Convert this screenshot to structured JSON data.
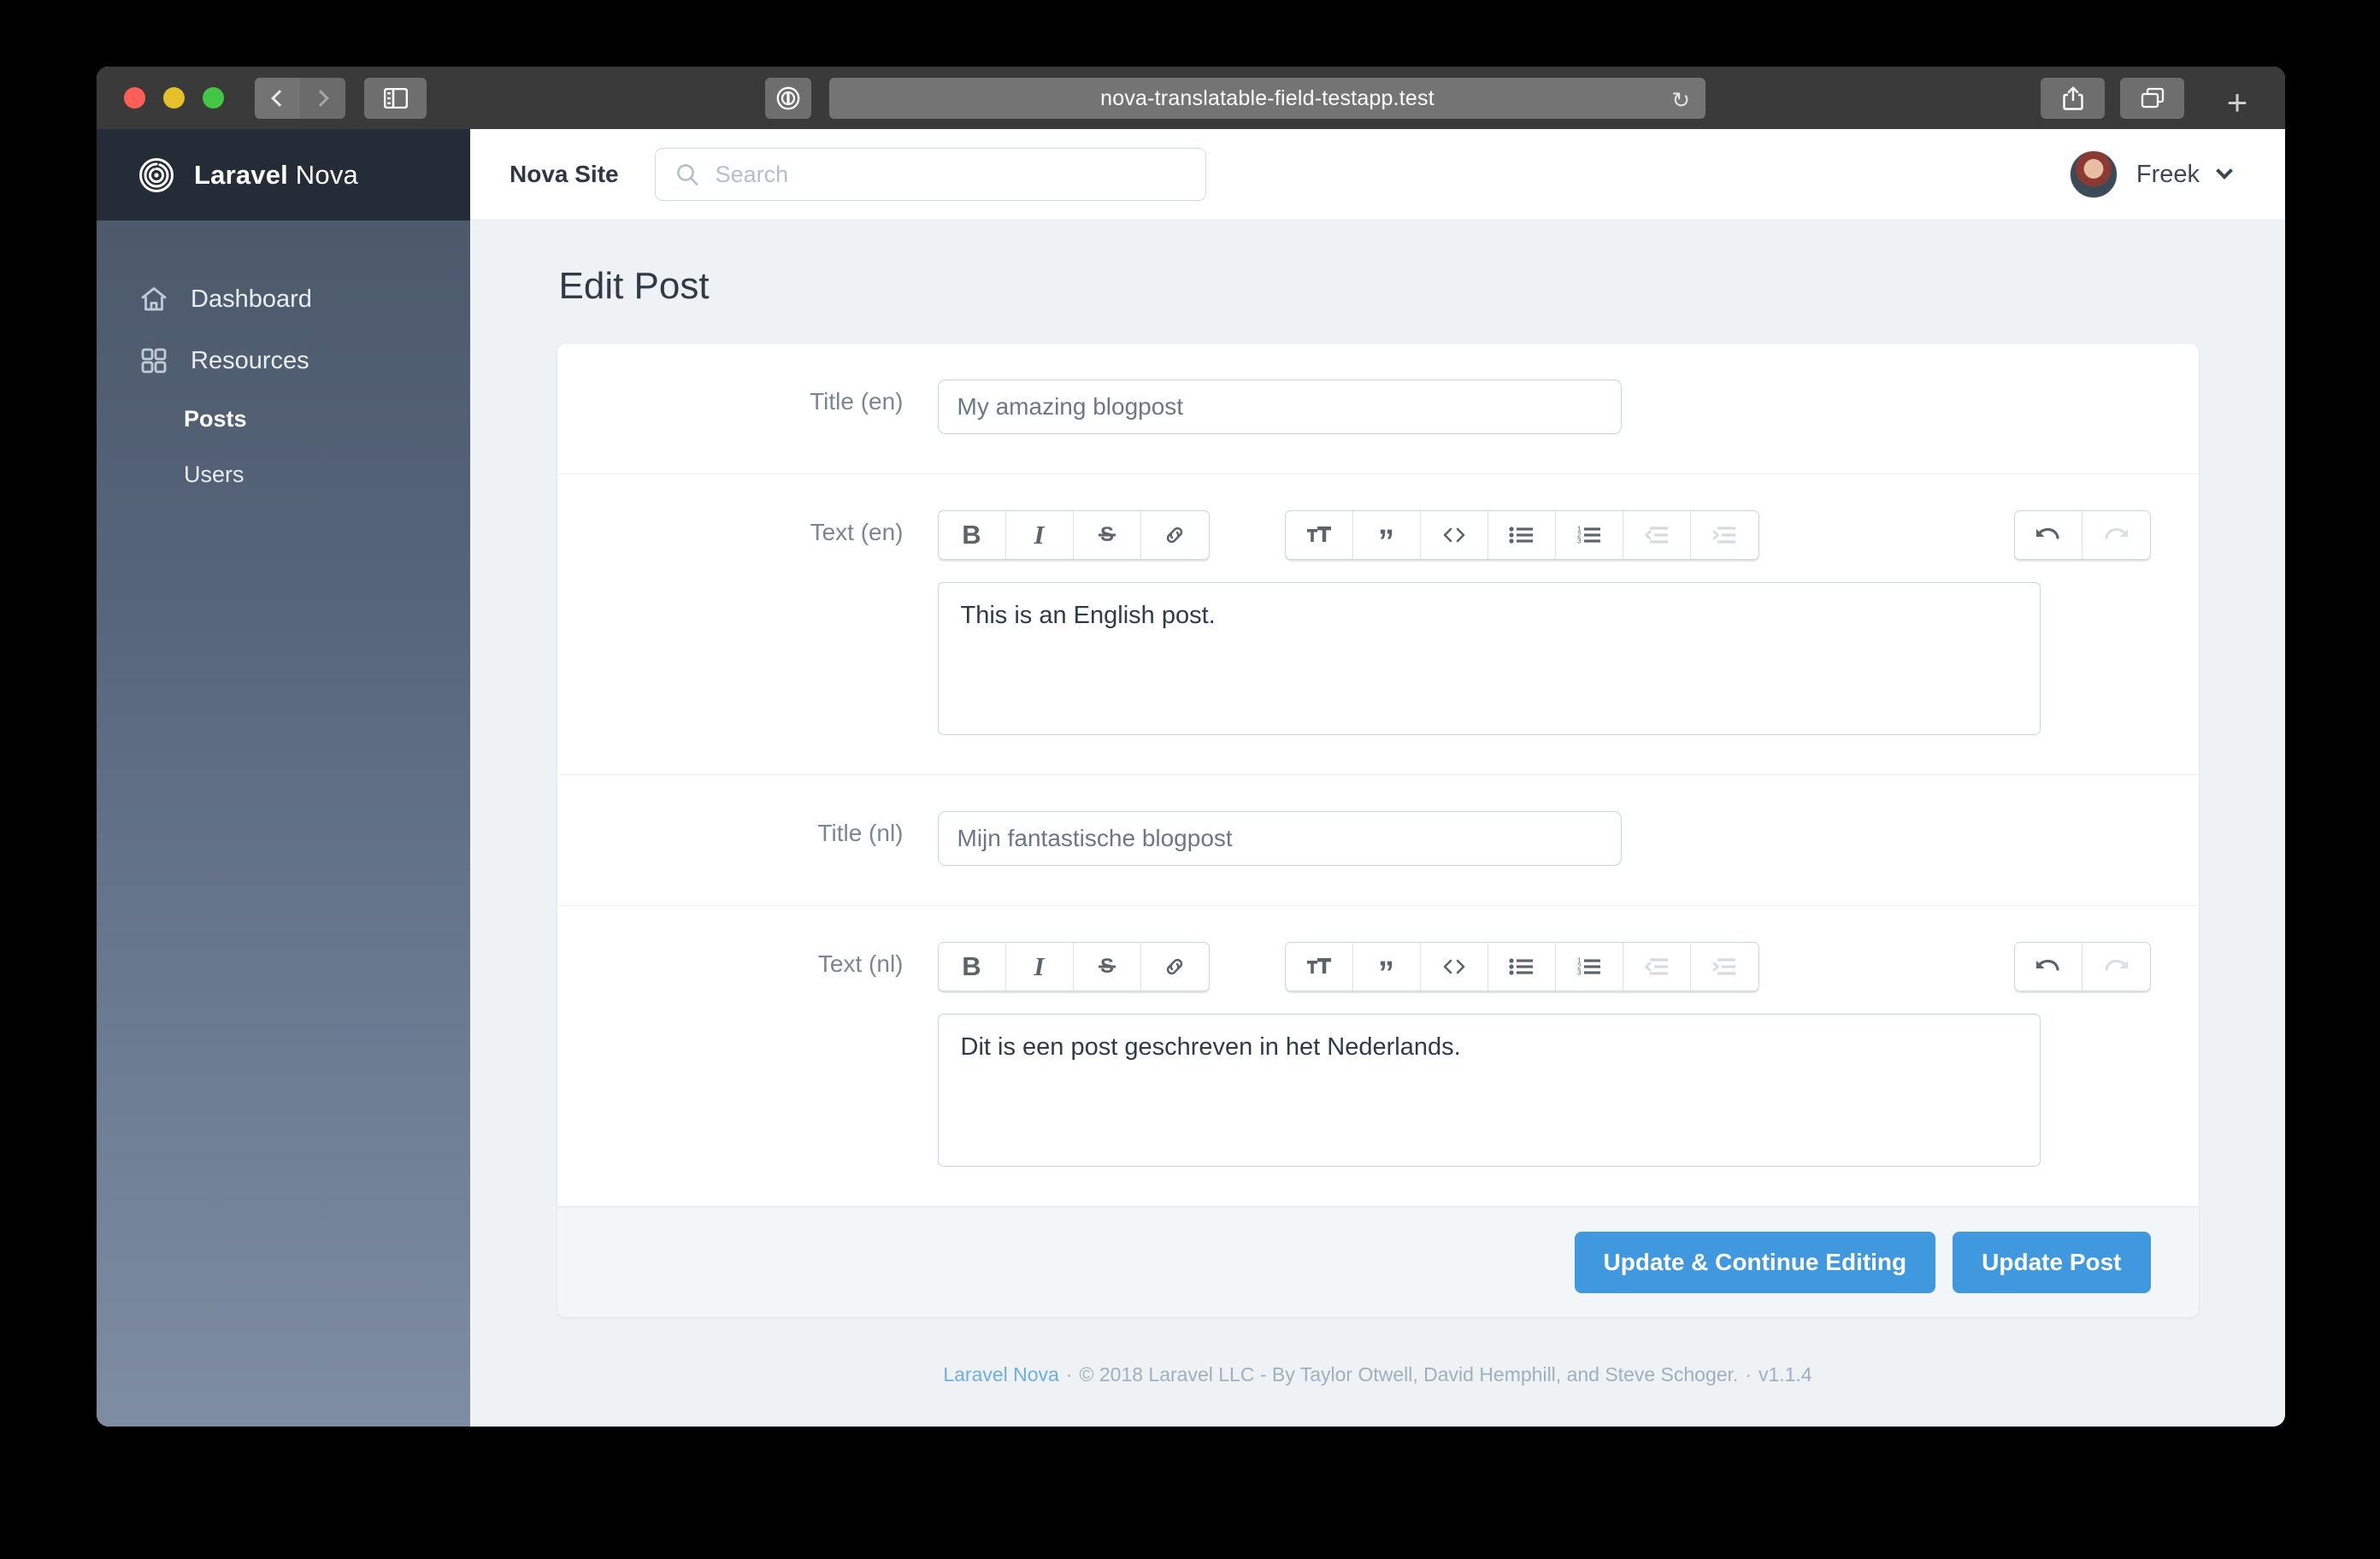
{
  "browser": {
    "url": "nova-translatable-field-testapp.test",
    "reader_icon": "reader-mode-icon",
    "reload_icon": "reload-icon",
    "back_icon": "back-icon",
    "forward_icon": "forward-icon",
    "sidebar_icon": "show-sidebar-icon",
    "share_icon": "share-icon",
    "tabs_icon": "tab-overview-icon",
    "new_tab_label": "+"
  },
  "sidebar": {
    "brand_bold": "Laravel",
    "brand_light": " Nova",
    "items": [
      {
        "label": "Dashboard",
        "icon": "home-icon"
      },
      {
        "label": "Resources",
        "icon": "grid-icon"
      }
    ],
    "sub_items": [
      {
        "label": "Posts",
        "active": true
      },
      {
        "label": "Users",
        "active": false
      }
    ]
  },
  "topbar": {
    "site_title": "Nova Site",
    "search_placeholder": "Search",
    "search_value": "",
    "search_icon": "search-icon",
    "user_name": "Freek",
    "avatar": "user-avatar",
    "caret_icon": "chevron-down-icon"
  },
  "page": {
    "title": "Edit Post"
  },
  "form": {
    "fields": [
      {
        "type": "text",
        "label": "Title (en)",
        "value": "My amazing blogpost",
        "placeholder": "Title (en)"
      },
      {
        "type": "rich",
        "label": "Text (en)",
        "content": "This is an English post."
      },
      {
        "type": "text",
        "label": "Title (nl)",
        "value": "Mijn fantastische blogpost",
        "placeholder": "Title (nl)"
      },
      {
        "type": "rich",
        "label": "Text (nl)",
        "content": "Dit is een post geschreven in het Nederlands."
      }
    ],
    "toolbar": {
      "group1": [
        {
          "icon": "bold-icon",
          "glyph": "B",
          "dim": false
        },
        {
          "icon": "italic-icon",
          "glyph": "I",
          "dim": false
        },
        {
          "icon": "strikethrough-icon",
          "glyph": "S",
          "dim": false
        },
        {
          "icon": "link-icon",
          "glyph": "link",
          "dim": false
        }
      ],
      "group2": [
        {
          "icon": "heading-icon",
          "glyph": "TT",
          "dim": false
        },
        {
          "icon": "blockquote-icon",
          "glyph": "quote",
          "dim": false
        },
        {
          "icon": "code-icon",
          "glyph": "<>",
          "dim": false
        },
        {
          "icon": "bullet-list-icon",
          "glyph": "ul",
          "dim": false
        },
        {
          "icon": "numbered-list-icon",
          "glyph": "ol",
          "dim": false
        },
        {
          "icon": "outdent-icon",
          "glyph": "outdent",
          "dim": true
        },
        {
          "icon": "indent-icon",
          "glyph": "indent",
          "dim": true
        }
      ],
      "group3": [
        {
          "icon": "undo-icon",
          "glyph": "undo",
          "dim": false
        },
        {
          "icon": "redo-icon",
          "glyph": "redo",
          "dim": true
        }
      ]
    }
  },
  "actions": {
    "update_continue": "Update & Continue Editing",
    "update_post": "Update Post",
    "accent_color": "#4099de"
  },
  "footer": {
    "link": "Laravel Nova",
    "sep": "·",
    "copyright": "© 2018 Laravel LLC - By Taylor Otwell, David Hemphill, and Steve Schoger.",
    "version": "v1.1.4"
  }
}
